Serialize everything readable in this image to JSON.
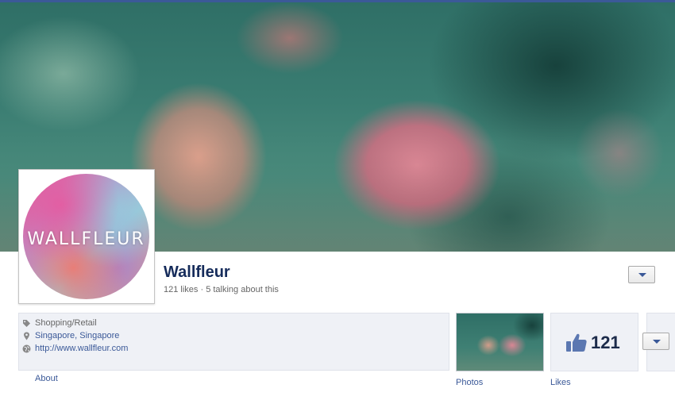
{
  "page": {
    "name": "Wallfleur",
    "stats": "121 likes · 5 talking about this",
    "profile_logo_text": "WALLFLEUR"
  },
  "info": {
    "category": "Shopping/Retail",
    "location": "Singapore, Singapore",
    "website": "http://www.wallfleur.com",
    "about_label": "About"
  },
  "apps": {
    "photos_label": "Photos",
    "likes_count": "121",
    "likes_label": "Likes"
  },
  "colors": {
    "brand_blue": "#3b5998",
    "name_color": "#162c5b",
    "info_bg": "#eff1f6"
  },
  "icons": {
    "category": "tag-icon",
    "location": "map-pin-icon",
    "website": "globe-icon",
    "likes": "thumbs-up-icon",
    "dropdown": "chevron-down-icon"
  }
}
